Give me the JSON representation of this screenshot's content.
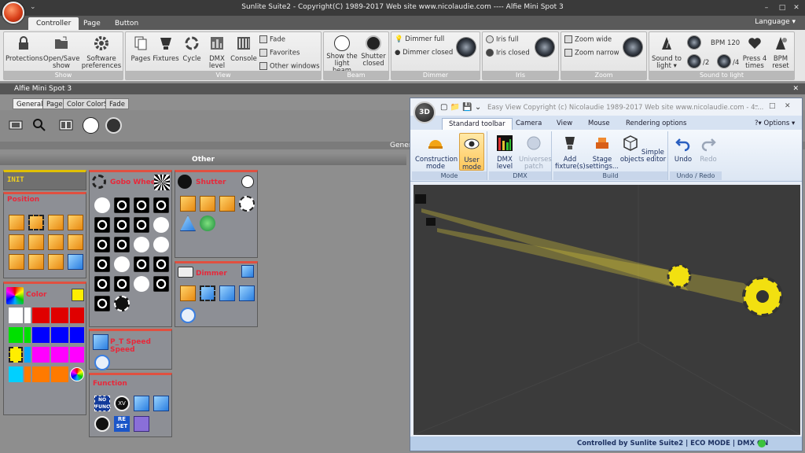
{
  "titlebar": {
    "title": "Sunlite Suite2 - Copyright(C) 1989-2017    Web site www.nicolaudie.com ---- Alfie Mini Spot 3",
    "quick_access": "⌄",
    "min": "–",
    "max": "□",
    "close": "✕"
  },
  "ribbon_tabs": [
    "Controller",
    "Page",
    "Button"
  ],
  "language_label": "Language ▾",
  "ribbon": {
    "show": {
      "label": "Show",
      "protections": "Protections",
      "open_save": "Open/Save show",
      "software_prefs": "Software preferences ▾"
    },
    "view": {
      "label": "View",
      "pages": "Pages",
      "fixtures": "Fixtures",
      "cycle": "Cycle",
      "dmx_level": "DMX level",
      "console": "Console",
      "fade": "Fade",
      "favorites": "Favorites",
      "other_windows": "Other windows"
    },
    "beam": {
      "label": "Beam",
      "show_light_beam": "Show the light beam",
      "shutter_closed": "Shutter closed"
    },
    "dimmer": {
      "label": "Dimmer",
      "dimmer_full": "Dimmer full",
      "dimmer_closed": "Dimmer closed"
    },
    "iris": {
      "label": "Iris",
      "iris_full": "Iris full",
      "iris_closed": "Iris closed"
    },
    "zoom": {
      "label": "Zoom",
      "zoom_wide": "Zoom wide",
      "zoom_narrow": "Zoom narrow"
    },
    "sound": {
      "label": "Sound to light",
      "sound_to_light": "Sound to light ▾",
      "bpm": "BPM 120",
      "div2": "/2",
      "div4": "/4",
      "press4": "Press 4 times",
      "bpm_reset": "BPM reset"
    }
  },
  "docbar": {
    "title": "Alfie Mini Spot 3",
    "close": "✕"
  },
  "sub_tabs": [
    "General",
    "Page",
    "Color ColorS",
    "Fade"
  ],
  "general_header": "Gener",
  "other_header": "Other",
  "panels": {
    "init": "INIT",
    "position": "Position",
    "color": "Color",
    "gobo": "Gobo Wheel",
    "shutter": "Shutter",
    "dimmer": "Dimmer",
    "pt_speed": "P_T Speed Speed",
    "function": "Function",
    "func_nofunc": "NO FUNC.",
    "func_reset": "RE SET"
  },
  "colors": {
    "swatches": [
      "#ffffff",
      "#ffffff",
      "#e00000",
      "#e00000",
      "#e00000",
      "#00e000",
      "#00e000",
      "#0000ff",
      "#0000ff",
      "#0000ff",
      "#ffee00",
      "#00aaff",
      "#ff00ff",
      "#ff00ff",
      "#ff00ff",
      "#00d0ff",
      "#ff7a00",
      "#ff7a00",
      "#ff7a00"
    ],
    "accent": "#e8283a"
  },
  "win3d": {
    "logo": "3D",
    "title": "Easy View   Copyright (c) Nicolaudie 1989-2017   Web site www.nicolaudie.com - 4....",
    "tabs": [
      "Standard toolbar",
      "Camera",
      "View",
      "Mouse",
      "Rendering options"
    ],
    "options": "?▾  Options ▾",
    "mode_label": "Mode",
    "construction": "Construction mode",
    "user_mode": "User mode",
    "dmx_label": "DMX",
    "dmx_level": "DMX level",
    "universes": "Universes patch",
    "build_label": "Build",
    "add_fixture": "Add fixture(s)",
    "stage_settings": "Stage settings...",
    "simple_objects": "Simple objects editor",
    "undo_label": "Undo / Redo",
    "undo": "Undo",
    "redo": "Redo",
    "status": "Controlled by Sunlite Suite2  |  ECO MODE  |  DMX ON"
  }
}
